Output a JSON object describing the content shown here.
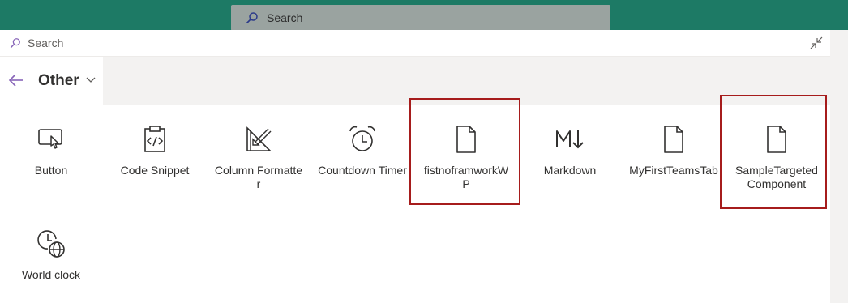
{
  "top_search": {
    "placeholder": "Search"
  },
  "panel_search": {
    "placeholder": "Search"
  },
  "category": {
    "title": "Other"
  },
  "tiles": [
    {
      "label": "Button",
      "icon": "button-icon"
    },
    {
      "label": "Code Snippet",
      "icon": "code-snippet-icon"
    },
    {
      "label": "Column Formatter",
      "icon": "column-formatter-icon"
    },
    {
      "label": "Countdown Timer",
      "icon": "alarm-clock-icon"
    },
    {
      "label": "fistnoframworkWP",
      "icon": "document-icon"
    },
    {
      "label": "Markdown",
      "icon": "markdown-icon"
    },
    {
      "label": "MyFirstTeamsTab",
      "icon": "document-icon"
    },
    {
      "label": "SampleTargetedComponent",
      "icon": "document-icon"
    },
    {
      "label": "World clock",
      "icon": "world-clock-icon"
    }
  ],
  "colors": {
    "topbar": "#1d7a65",
    "accent": "#8764b8",
    "highlight": "#a61c1c"
  }
}
